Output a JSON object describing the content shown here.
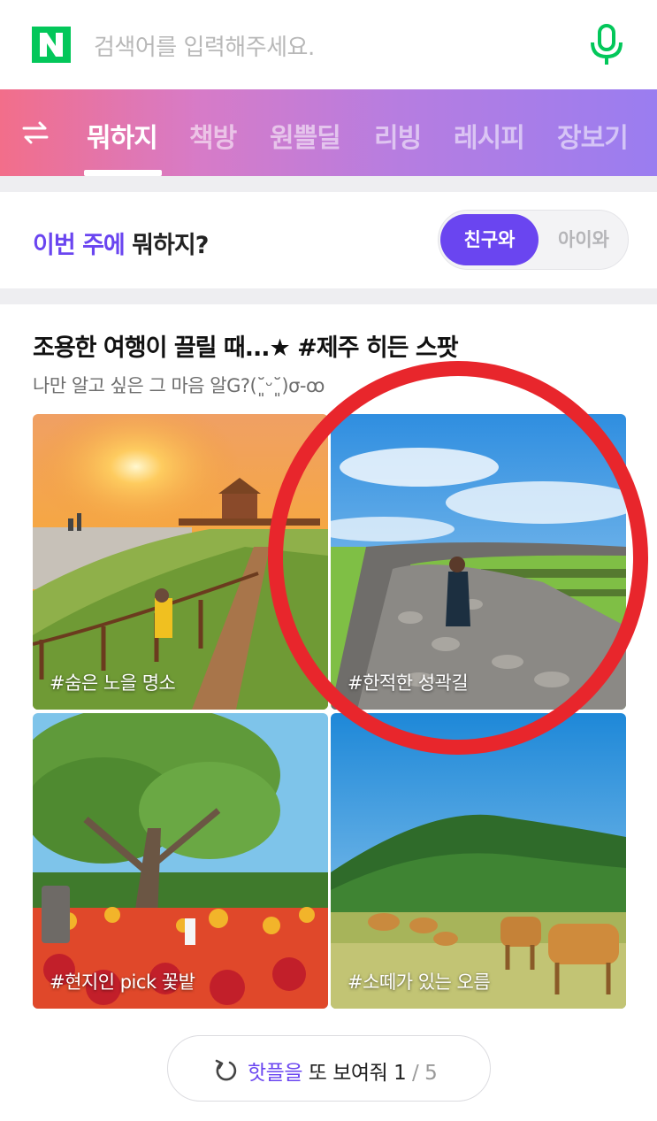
{
  "search": {
    "logo": "N",
    "placeholder": "검색어를 입력해주세요.",
    "mic_icon": "microphone-icon"
  },
  "nav": {
    "swap_icon": "swap-arrows-icon",
    "items": [
      {
        "label": "뭐하지",
        "active": true
      },
      {
        "label": "책방",
        "active": false
      },
      {
        "label": "원쁠딜",
        "active": false
      },
      {
        "label": "리빙",
        "active": false
      },
      {
        "label": "레시피",
        "active": false
      },
      {
        "label": "장보기",
        "active": false
      }
    ]
  },
  "week": {
    "accent": "이번 주에",
    "rest": "뭐하지?",
    "toggle_on": "친구와",
    "toggle_off": "아이와"
  },
  "feature": {
    "title": "조용한 여행이 끌릴 때...★ #제주 히든 스팟",
    "subtitle": "나만 알고 싶은 그 마음 알G?(˘͈ᵕ˘͈)σ-ꝏ",
    "cards": [
      {
        "label": "#숨은 노을 명소"
      },
      {
        "label": "#한적한 성곽길"
      },
      {
        "label": "#현지인 pick 꽃밭"
      },
      {
        "label": "#소떼가 있는 오름"
      }
    ]
  },
  "more": {
    "hot": "핫플을",
    "text": " 또 보여줘 ",
    "page": "1",
    "total": " / 5",
    "icon": "refresh-icon"
  },
  "colors": {
    "naver_green": "#03c75a",
    "accent_purple": "#6a45f0",
    "highlight_red": "#e8262c"
  }
}
